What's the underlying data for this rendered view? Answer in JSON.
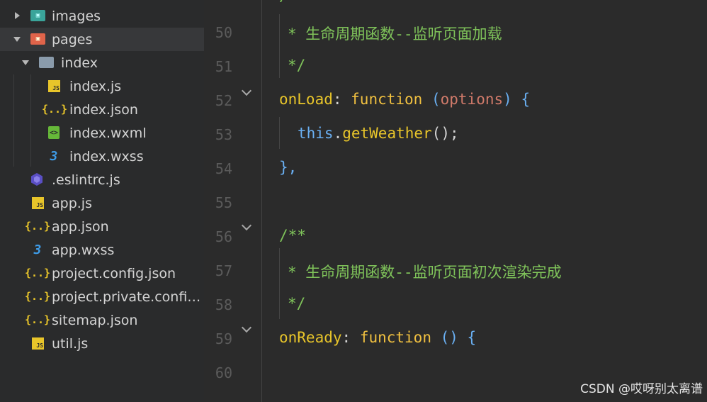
{
  "tree": [
    {
      "label": "images",
      "icon": "image-folder-icon",
      "glyph": "▣",
      "type": "folder",
      "expanded": false
    },
    {
      "label": "pages",
      "icon": "pages-folder-icon",
      "glyph": "▣",
      "type": "folder",
      "expanded": true
    },
    {
      "label": "index",
      "icon": "folder-icon",
      "glyph": "",
      "type": "folder",
      "expanded": true
    },
    {
      "label": "index.js",
      "icon": "js-file-icon",
      "glyph": "JS",
      "type": "js"
    },
    {
      "label": "index.json",
      "icon": "json-file-icon",
      "glyph": "{..}",
      "type": "json"
    },
    {
      "label": "index.wxml",
      "icon": "wxml-file-icon",
      "glyph": "<>",
      "type": "wxml"
    },
    {
      "label": "index.wxss",
      "icon": "css-file-icon",
      "glyph": "3",
      "type": "css"
    },
    {
      "label": ".eslintrc.js",
      "icon": "eslint-file-icon",
      "glyph": "",
      "type": "eslint"
    },
    {
      "label": "app.js",
      "icon": "js-file-icon",
      "glyph": "JS",
      "type": "js"
    },
    {
      "label": "app.json",
      "icon": "json-file-icon",
      "glyph": "{..}",
      "type": "json"
    },
    {
      "label": "app.wxss",
      "icon": "css-file-icon",
      "glyph": "3",
      "type": "css"
    },
    {
      "label": "project.config.json",
      "icon": "json-file-icon",
      "glyph": "{..}",
      "type": "json"
    },
    {
      "label": "project.private.config.js...",
      "icon": "json-file-icon",
      "glyph": "{..}",
      "type": "json"
    },
    {
      "label": "sitemap.json",
      "icon": "json-file-icon",
      "glyph": "{..}",
      "type": "json"
    },
    {
      "label": "util.js",
      "icon": "js-file-icon",
      "glyph": "JS",
      "type": "js"
    }
  ],
  "editor": {
    "line_numbers": [
      "50",
      "51",
      "52",
      "53",
      "54",
      "55",
      "56",
      "57",
      "58",
      "59",
      "60"
    ],
    "lines": {
      "l50": "* 生命周期函数--监听页面加载",
      "l51": "*/",
      "l52_key": "onLoad",
      "l52_colon": ": ",
      "l52_kw": "function",
      "l52_sp": " ",
      "l52_po": "(",
      "l52_param": "options",
      "l52_pc": ")",
      "l52_brace": " {",
      "l53_this": "this",
      "l53_dot": ".",
      "l53_fn": "getWeather",
      "l53_rest": "();",
      "l54": "},",
      "l56": "/**",
      "l57": "* 生命周期函数--监听页面初次渲染完成",
      "l58": "*/",
      "l59_key": "onReady",
      "l59_colon": ": ",
      "l59_kw": "function",
      "l59_paren": " ()",
      "l59_brace": " {"
    }
  },
  "watermark": "CSDN @哎呀别太离谱"
}
